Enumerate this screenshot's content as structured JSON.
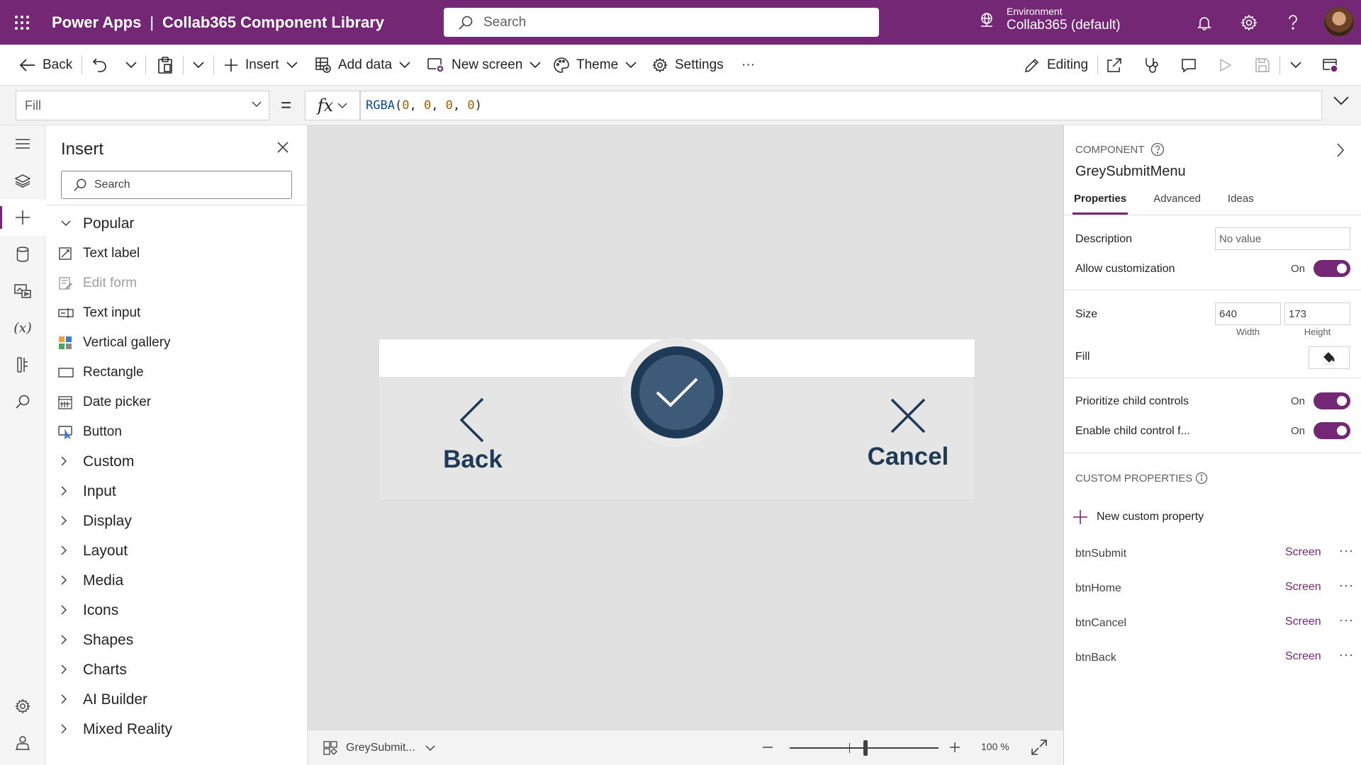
{
  "header": {
    "app_name": "Power Apps",
    "separator": "|",
    "project_title": "Collab365 Component Library",
    "search_placeholder": "Search",
    "environment_label": "Environment",
    "environment_value": "Collab365 (default)",
    "accent_color": "#742774"
  },
  "toolbar": {
    "back": "Back",
    "insert": "Insert",
    "add_data": "Add data",
    "new_screen": "New screen",
    "theme": "Theme",
    "settings": "Settings",
    "more": "···",
    "editing": "Editing"
  },
  "formula_bar": {
    "property": "Fill",
    "equals": "=",
    "fx": "fx",
    "formula_fn": "RGBA",
    "formula_args": [
      "0",
      "0",
      "0",
      "0"
    ]
  },
  "left_rail": {
    "icons": [
      "hamburger-icon",
      "layers-icon",
      "plus-icon",
      "database-icon",
      "media-icon",
      "variables-icon",
      "tools-icon",
      "search-icon",
      "settings-icon",
      "virtual-agent-icon"
    ],
    "variables_glyph": "(x)"
  },
  "insert_panel": {
    "title": "Insert",
    "search_placeholder": "Search",
    "popular_label": "Popular",
    "popular_items": [
      {
        "label": "Text label",
        "icon": "text-label-icon",
        "disabled": false
      },
      {
        "label": "Edit form",
        "icon": "edit-form-icon",
        "disabled": true
      },
      {
        "label": "Text input",
        "icon": "text-input-icon",
        "disabled": false
      },
      {
        "label": "Vertical gallery",
        "icon": "gallery-icon",
        "disabled": false
      },
      {
        "label": "Rectangle",
        "icon": "rectangle-icon",
        "disabled": false
      },
      {
        "label": "Date picker",
        "icon": "calendar-icon",
        "disabled": false
      },
      {
        "label": "Button",
        "icon": "button-icon",
        "disabled": false
      }
    ],
    "categories": [
      "Custom",
      "Input",
      "Display",
      "Layout",
      "Media",
      "Icons",
      "Shapes",
      "Charts",
      "AI Builder",
      "Mixed Reality"
    ]
  },
  "canvas": {
    "back_label": "Back",
    "cancel_label": "Cancel",
    "submit_icon": "checkmark-icon",
    "component_color": "#1f3a56",
    "background_color": "#e1e1e1"
  },
  "canvas_footer": {
    "screen_name": "GreySubmit...",
    "zoom_value": "100 %",
    "zoom_percent": 100
  },
  "properties": {
    "kind": "COMPONENT",
    "name": "GreySubmitMenu",
    "tabs": [
      "Properties",
      "Advanced",
      "Ideas"
    ],
    "active_tab": "Properties",
    "description_label": "Description",
    "description_placeholder": "No value",
    "allow_customization_label": "Allow customization",
    "allow_customization_state": "On",
    "size_label": "Size",
    "width_value": "640",
    "height_value": "173",
    "width_label": "Width",
    "height_label": "Height",
    "fill_label": "Fill",
    "prioritize_label": "Prioritize child controls",
    "prioritize_state": "On",
    "enable_child_label": "Enable child control f...",
    "enable_child_state": "On",
    "custom_props_header": "CUSTOM PROPERTIES",
    "new_custom_property": "New custom property",
    "custom_props": [
      {
        "name": "btnSubmit",
        "type": "Screen"
      },
      {
        "name": "btnHome",
        "type": "Screen"
      },
      {
        "name": "btnCancel",
        "type": "Screen"
      },
      {
        "name": "btnBack",
        "type": "Screen"
      }
    ],
    "more": "···"
  }
}
